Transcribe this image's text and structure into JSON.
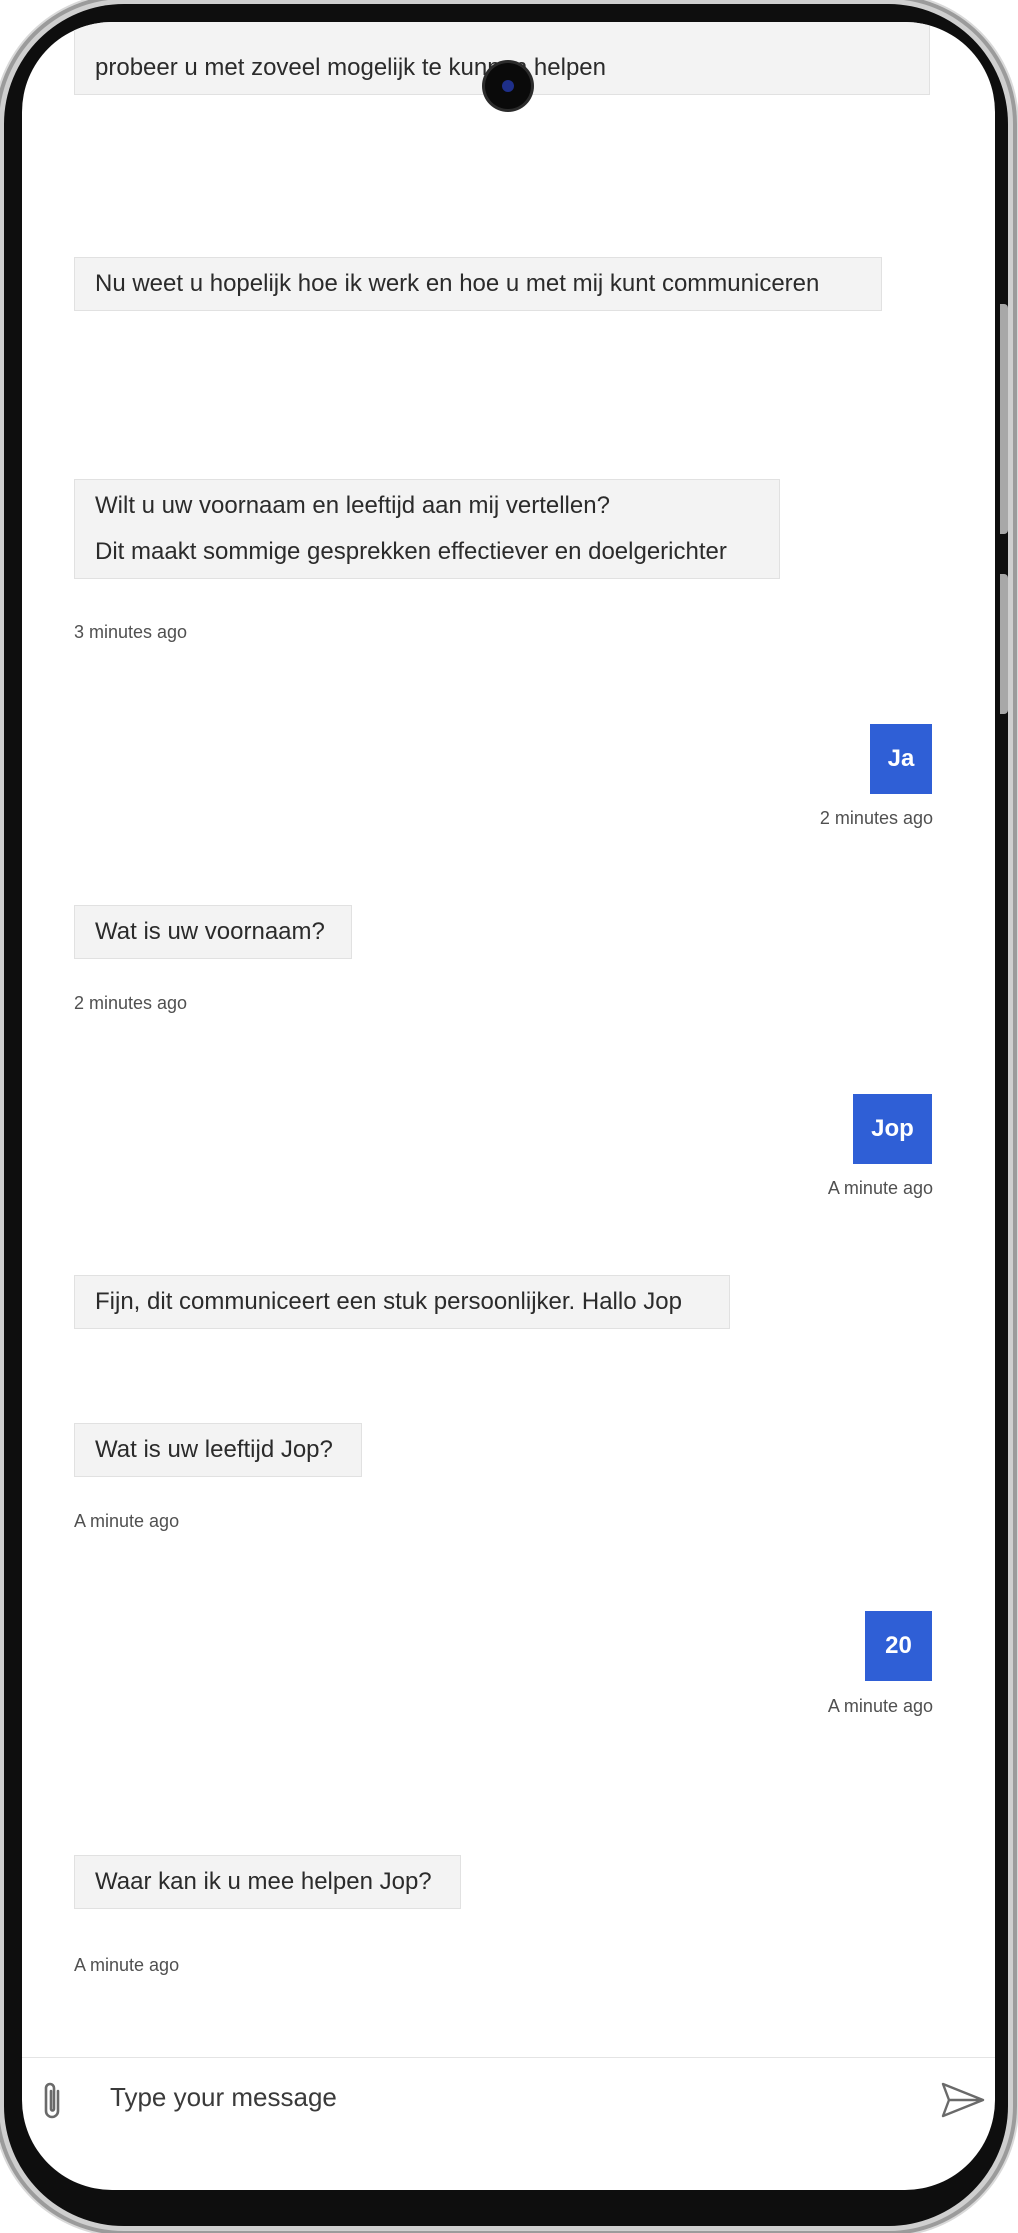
{
  "messages": [
    {
      "role": "bot",
      "lines": [
        "probeer u met zoveel mogelijk te kunnen helpen"
      ]
    },
    {
      "role": "bot",
      "lines": [
        "Nu weet u hopelijk hoe ik werk en hoe u met mij kunt communiceren"
      ]
    },
    {
      "role": "bot",
      "lines": [
        "Wilt u uw voornaam en leeftijd aan mij vertellen?",
        "Dit maakt sommige gesprekken effectiever en doelgerichter"
      ],
      "time": "3 minutes ago"
    },
    {
      "role": "user",
      "text": "Ja",
      "time": "2 minutes ago"
    },
    {
      "role": "bot",
      "lines": [
        "Wat is uw voornaam?"
      ],
      "time": "2 minutes ago"
    },
    {
      "role": "user",
      "text": "Jop",
      "time": "A minute ago"
    },
    {
      "role": "bot",
      "lines": [
        "Fijn, dit communiceert een stuk persoonlijker. Hallo Jop"
      ]
    },
    {
      "role": "bot",
      "lines": [
        "Wat is uw leeftijd Jop?"
      ],
      "time": "A minute ago"
    },
    {
      "role": "user",
      "text": "20",
      "time": "A minute ago"
    },
    {
      "role": "bot",
      "lines": [
        "Waar kan ik u mee helpen Jop?"
      ],
      "time": "A minute ago"
    }
  ],
  "composer": {
    "placeholder": "Type your message",
    "attach_icon": "paperclip-icon",
    "send_icon": "send-icon"
  },
  "colors": {
    "user_bubble": "#2f5fd6",
    "bot_bubble": "#f3f3f3"
  }
}
